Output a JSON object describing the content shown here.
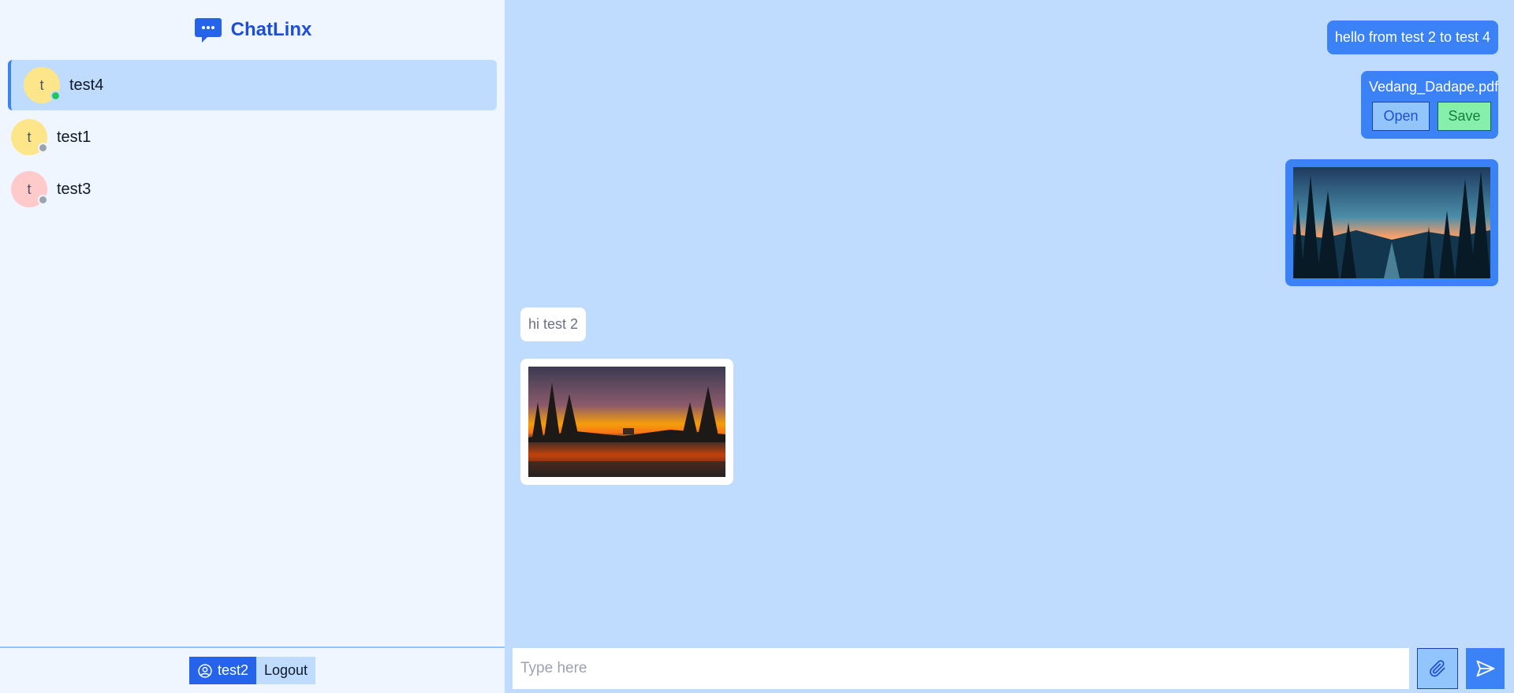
{
  "app": {
    "name": "ChatLinx",
    "accent": "#2563eb"
  },
  "contacts": [
    {
      "name": "test4",
      "initial": "t",
      "avatar_color": "#fde68a",
      "status": "online",
      "status_color": "#22c55e",
      "active": true
    },
    {
      "name": "test1",
      "initial": "t",
      "avatar_color": "#fde68a",
      "status": "offline",
      "status_color": "#9ca3af",
      "active": false
    },
    {
      "name": "test3",
      "initial": "t",
      "avatar_color": "#fecaca",
      "status": "offline",
      "status_color": "#9ca3af",
      "active": false
    }
  ],
  "footer": {
    "username": "test2",
    "user_icon": "user-circle-icon",
    "logout_label": "Logout"
  },
  "messages": [
    {
      "direction": "out",
      "type": "text",
      "text": "hello from test 2 to test 4"
    },
    {
      "direction": "out",
      "type": "file",
      "filename": "Vedang_Dadape.pdf",
      "open_label": "Open",
      "save_label": "Save"
    },
    {
      "direction": "out",
      "type": "image",
      "description_icon": "forest-sunset-image"
    },
    {
      "direction": "in",
      "type": "text",
      "text": "hi test 2"
    },
    {
      "direction": "in",
      "type": "image",
      "description_icon": "lake-sunset-image"
    }
  ],
  "composer": {
    "placeholder": "Type here",
    "value": "",
    "attach_icon": "paperclip-icon",
    "send_icon": "send-icon"
  }
}
